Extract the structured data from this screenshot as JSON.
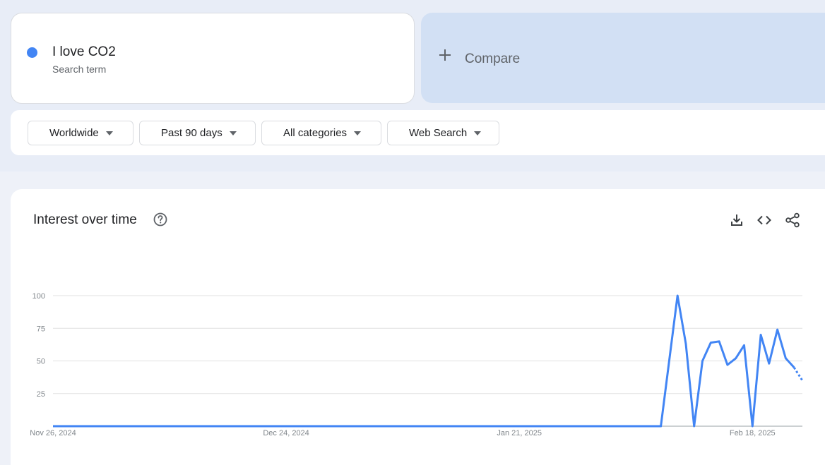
{
  "search_term": {
    "name": "I love CO2",
    "subtitle": "Search term",
    "color": "#4285f4"
  },
  "compare": {
    "label": "Compare"
  },
  "filters": [
    {
      "label": "Worldwide"
    },
    {
      "label": "Past 90 days"
    },
    {
      "label": "All categories"
    },
    {
      "label": "Web Search"
    }
  ],
  "interest_section": {
    "title": "Interest over time"
  },
  "icons": {
    "help": "help-circle-icon",
    "download": "download-icon",
    "embed": "code-embed-icon",
    "share": "share-icon"
  },
  "chart_data": {
    "type": "line",
    "title": "Interest over time",
    "xlabel": "",
    "ylabel": "",
    "ylim": [
      0,
      100
    ],
    "yticks": [
      25,
      50,
      75,
      100
    ],
    "x_ticks": [
      "Nov 26, 2024",
      "Dec 24, 2024",
      "Jan 21, 2025",
      "Feb 18, 2025"
    ],
    "x_start": "2024-11-26",
    "x_end": "2025-02-24",
    "grid": true,
    "series": [
      {
        "name": "I love CO2",
        "color": "#4285f4",
        "x": [
          "2024-11-26",
          "2025-02-07",
          "2025-02-08",
          "2025-02-09",
          "2025-02-10",
          "2025-02-11",
          "2025-02-12",
          "2025-02-13",
          "2025-02-14",
          "2025-02-15",
          "2025-02-16",
          "2025-02-17",
          "2025-02-18",
          "2025-02-19",
          "2025-02-20",
          "2025-02-21",
          "2025-02-22",
          "2025-02-23",
          "2025-02-24"
        ],
        "values": [
          0,
          0,
          50,
          100,
          63,
          0,
          50,
          64,
          65,
          47,
          52,
          62,
          0,
          70,
          48,
          74,
          52,
          45,
          35
        ],
        "partial_from": "2025-02-23"
      }
    ]
  }
}
